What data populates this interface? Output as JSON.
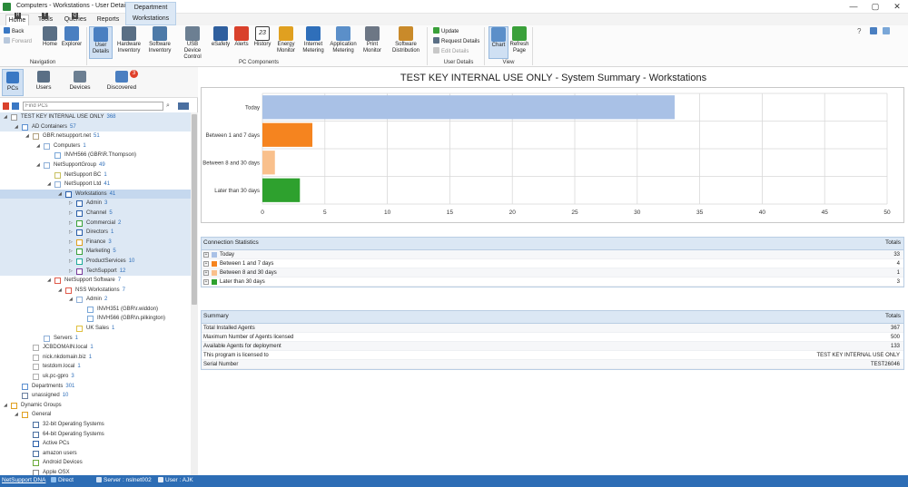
{
  "window": {
    "title": "Computers - Workstations - User Details",
    "controls": [
      "—",
      "▢",
      "✕"
    ]
  },
  "ribbon_tabs": [
    {
      "label": "Home",
      "keytip": "H"
    },
    {
      "label": "Tools",
      "keytip": "T"
    },
    {
      "label": "Queries",
      "keytip": "Q"
    },
    {
      "label": "Reports",
      "keytip": ""
    }
  ],
  "context_tab": {
    "header": "Department",
    "label": "Workstations"
  },
  "ribbon": {
    "nav": {
      "back": "Back",
      "forward": "Forward",
      "home": "Home",
      "explorer": "Explorer",
      "group": "Navigation"
    },
    "pc": [
      {
        "label": "User Details",
        "sel": true,
        "color": "#4a7fc1"
      },
      {
        "label": "Hardware Inventory",
        "sel": false,
        "color": "#5a6f85"
      },
      {
        "label": "Software Inventory",
        "sel": false,
        "color": "#4d7aa8"
      },
      {
        "label": "USB Device Control",
        "sel": false,
        "color": "#6c7f92"
      },
      {
        "label": "eSafety",
        "sel": false,
        "color": "#2f5f9e"
      },
      {
        "label": "Alerts",
        "sel": false,
        "color": "#d9412c"
      },
      {
        "label": "History",
        "sel": false,
        "color": "#3a3a3a"
      },
      {
        "label": "Energy Monitor",
        "sel": false,
        "color": "#e0a020"
      },
      {
        "label": "Internet Metering",
        "sel": false,
        "color": "#2f6fba"
      },
      {
        "label": "Application Metering",
        "sel": false,
        "color": "#5b8fc9"
      },
      {
        "label": "Print Monitor",
        "sel": false,
        "color": "#6d7785"
      },
      {
        "label": "Software Distribution",
        "sel": false,
        "color": "#c98a2a"
      }
    ],
    "pc_group": "PC Components",
    "calendar_day": "23",
    "user": {
      "update": "Update",
      "request": "Request Details",
      "edit": "Edit Details",
      "group": "User Details"
    },
    "view": {
      "chart": "Chart",
      "refresh": "Refresh Page",
      "group": "View"
    }
  },
  "left_nav": {
    "tabs": [
      "PCs",
      "Users",
      "Devices",
      "Discovered"
    ],
    "discovered_badge": "3",
    "find_placeholder": "Find PCs"
  },
  "tree": [
    {
      "indent": 0,
      "arrow": "◢",
      "label": "TEST KEY INTERNAL USE ONLY",
      "count": "368",
      "color": "#9a9a9a",
      "hl": true,
      "sel": false
    },
    {
      "indent": 1,
      "arrow": "◢",
      "label": "AD Containers",
      "count": "57",
      "color": "#5b8fd0",
      "hl": true,
      "sel": false
    },
    {
      "indent": 2,
      "arrow": "◢",
      "label": "GBR.netsupport.net",
      "count": "51",
      "color": "#b0a080",
      "hl": false,
      "sel": false
    },
    {
      "indent": 3,
      "arrow": "◢",
      "label": "Computers",
      "count": "1",
      "color": "#8fb0d8",
      "hl": false,
      "sel": false
    },
    {
      "indent": 4,
      "arrow": "",
      "label": "INVH566 (GBR\\R.Thompson)",
      "count": "",
      "color": "#7aa7d8",
      "hl": false,
      "sel": false
    },
    {
      "indent": 3,
      "arrow": "◢",
      "label": "NetSupportGroup",
      "count": "49",
      "color": "#8fb0d8",
      "hl": false,
      "sel": false
    },
    {
      "indent": 4,
      "arrow": "",
      "label": "NetSupport BC",
      "count": "1",
      "color": "#c8c060",
      "hl": false,
      "sel": false
    },
    {
      "indent": 4,
      "arrow": "◢",
      "label": "NetSupport Ltd",
      "count": "41",
      "color": "#8fb0d8",
      "hl": false,
      "sel": false
    },
    {
      "indent": 5,
      "arrow": "◢",
      "label": "Workstations",
      "count": "41",
      "color": "#2a5ea8",
      "hl": false,
      "sel": true
    },
    {
      "indent": 6,
      "arrow": "▷",
      "label": "Admin",
      "count": "3",
      "color": "#2a5ea8",
      "hl": true,
      "sel": false
    },
    {
      "indent": 6,
      "arrow": "▷",
      "label": "Channel",
      "count": "5",
      "color": "#2a5ea8",
      "hl": true,
      "sel": false
    },
    {
      "indent": 6,
      "arrow": "▷",
      "label": "Commercial",
      "count": "2",
      "color": "#3aa03a",
      "hl": true,
      "sel": false
    },
    {
      "indent": 6,
      "arrow": "▷",
      "label": "Directors",
      "count": "1",
      "color": "#2a5ea8",
      "hl": true,
      "sel": false
    },
    {
      "indent": 6,
      "arrow": "▷",
      "label": "Finance",
      "count": "3",
      "color": "#e0a020",
      "hl": true,
      "sel": false
    },
    {
      "indent": 6,
      "arrow": "▷",
      "label": "Marketing",
      "count": "5",
      "color": "#3aa03a",
      "hl": true,
      "sel": false
    },
    {
      "indent": 6,
      "arrow": "▷",
      "label": "ProductServices",
      "count": "10",
      "color": "#1faa9a",
      "hl": true,
      "sel": false
    },
    {
      "indent": 6,
      "arrow": "▷",
      "label": "TechSupport",
      "count": "12",
      "color": "#7a3a9a",
      "hl": true,
      "sel": false
    },
    {
      "indent": 4,
      "arrow": "◢",
      "label": "NetSupport Software",
      "count": "7",
      "color": "#e05a4a",
      "hl": false,
      "sel": false
    },
    {
      "indent": 5,
      "arrow": "◢",
      "label": "NSS Workstations",
      "count": "7",
      "color": "#e05a4a",
      "hl": false,
      "sel": false
    },
    {
      "indent": 6,
      "arrow": "◢",
      "label": "Admin",
      "count": "2",
      "color": "#8fb0d8",
      "hl": false,
      "sel": false
    },
    {
      "indent": 7,
      "arrow": "",
      "label": "INVH351 (GBR\\r.widdon)",
      "count": "",
      "color": "#7aa7d8",
      "hl": false,
      "sel": false
    },
    {
      "indent": 7,
      "arrow": "",
      "label": "INVH566 (GBR\\n.pilkington)",
      "count": "",
      "color": "#7aa7d8",
      "hl": false,
      "sel": false
    },
    {
      "indent": 6,
      "arrow": "",
      "label": "UK Sales",
      "count": "1",
      "color": "#e0c040",
      "hl": false,
      "sel": false
    },
    {
      "indent": 3,
      "arrow": "",
      "label": "Servers",
      "count": "1",
      "color": "#8fb0d8",
      "hl": false,
      "sel": false
    },
    {
      "indent": 2,
      "arrow": "",
      "label": "JCBDOMAIN.local",
      "count": "1",
      "color": "#b0b0b0",
      "hl": false,
      "sel": false
    },
    {
      "indent": 2,
      "arrow": "",
      "label": "nick.nkdomain.biz",
      "count": "1",
      "color": "#b0b0b0",
      "hl": false,
      "sel": false
    },
    {
      "indent": 2,
      "arrow": "",
      "label": "testdom.local",
      "count": "1",
      "color": "#b0b0b0",
      "hl": false,
      "sel": false
    },
    {
      "indent": 2,
      "arrow": "",
      "label": "uk.pc-gpro",
      "count": "3",
      "color": "#b0b0b0",
      "hl": false,
      "sel": false
    },
    {
      "indent": 1,
      "arrow": "",
      "label": "Departments",
      "count": "301",
      "color": "#5b8fd0",
      "hl": false,
      "sel": false
    },
    {
      "indent": 1,
      "arrow": "",
      "label": "unassigned",
      "count": "10",
      "color": "#6a7fa0",
      "hl": false,
      "sel": false
    },
    {
      "indent": 0,
      "arrow": "◢",
      "label": "Dynamic Groups",
      "count": "",
      "color": "#e0a020",
      "hl": false,
      "sel": false
    },
    {
      "indent": 1,
      "arrow": "◢",
      "label": "General",
      "count": "",
      "color": "#e0a020",
      "hl": false,
      "sel": false
    },
    {
      "indent": 2,
      "arrow": "",
      "label": "32-bit Operating Systems",
      "count": "",
      "color": "#4a6fa0",
      "hl": false,
      "sel": false
    },
    {
      "indent": 2,
      "arrow": "",
      "label": "64-bit Operating Systems",
      "count": "",
      "color": "#4a6fa0",
      "hl": false,
      "sel": false
    },
    {
      "indent": 2,
      "arrow": "",
      "label": "Active PCs",
      "count": "",
      "color": "#2a5ea8",
      "hl": false,
      "sel": false
    },
    {
      "indent": 2,
      "arrow": "",
      "label": "amazon users",
      "count": "",
      "color": "#4a6fa0",
      "hl": false,
      "sel": false
    },
    {
      "indent": 2,
      "arrow": "",
      "label": "Android Devices",
      "count": "",
      "color": "#6aaa3a",
      "hl": false,
      "sel": false
    },
    {
      "indent": 2,
      "arrow": "",
      "label": "Apple OSX",
      "count": "",
      "color": "#888888",
      "hl": false,
      "sel": false
    }
  ],
  "report": {
    "title": "TEST KEY INTERNAL USE ONLY - System Summary - Workstations"
  },
  "chart_data": {
    "type": "bar",
    "orientation": "horizontal",
    "categories": [
      "Today",
      "Between 1 and 7 days",
      "Between 8 and 30 days",
      "Later than 30 days"
    ],
    "values": [
      33,
      4,
      1,
      3
    ],
    "colors": [
      "#a9c1e6",
      "#f5841f",
      "#f9c08c",
      "#2ea12e"
    ],
    "xlim": [
      0,
      50
    ],
    "xticks": [
      "0",
      "5",
      "10",
      "15",
      "20",
      "25",
      "30",
      "35",
      "40",
      "45",
      "50"
    ],
    "grid": true
  },
  "connection_stats": {
    "title": "Connection Statistics",
    "col": "Totals",
    "rows": [
      {
        "label": "Today",
        "value": "33",
        "color": "#a9c1e6"
      },
      {
        "label": "Between 1 and 7 days",
        "value": "4",
        "color": "#f5841f"
      },
      {
        "label": "Between 8 and 30 days",
        "value": "1",
        "color": "#f9c08c"
      },
      {
        "label": "Later than 30 days",
        "value": "3",
        "color": "#2ea12e"
      }
    ]
  },
  "summary": {
    "title": "Summary",
    "col": "Totals",
    "rows": [
      {
        "label": "Total Installed Agents",
        "value": "367"
      },
      {
        "label": "Maximum Number of Agents licensed",
        "value": "500"
      },
      {
        "label": "Available Agents for deployment",
        "value": "133"
      },
      {
        "label": "This program is licensed to",
        "value": "TEST KEY INTERNAL USE ONLY"
      },
      {
        "label": "Serial Number",
        "value": "TEST26046"
      }
    ]
  },
  "status": {
    "product": "NetSupport DNA",
    "mode": "Direct",
    "server": "Server : nslnet002",
    "user": "User : AJK"
  }
}
